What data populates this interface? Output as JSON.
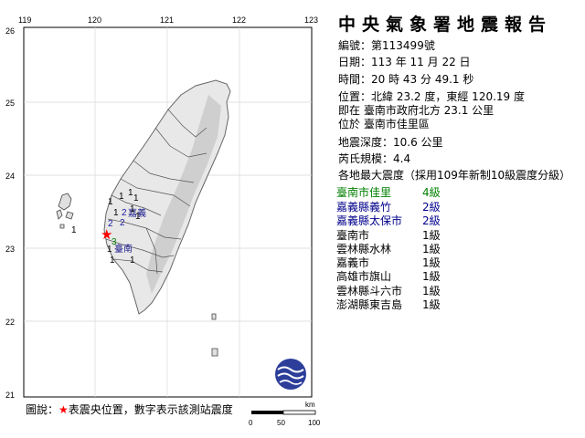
{
  "report": {
    "title": "中央氣象署地震報告",
    "number_label": "編號：",
    "number": "第113499號",
    "date_label": "日期：",
    "date": "113 年 11 月 22 日",
    "time_label": "時間：",
    "time": "20 時 43 分 49.1 秒",
    "position_label": "位置：",
    "position": "北緯 23.2 度，東經 120.19 度",
    "relative_line": "即在 臺南市政府北方 23.1 公里",
    "located_line": "位於 臺南市佳里區",
    "depth_label": "地震深度：",
    "depth": "10.6 公里",
    "magnitude_label": "芮氏規模：",
    "magnitude": "4.4",
    "intensity_heading": "各地最大震度（採用109年新制10級震度分級）"
  },
  "stations": [
    {
      "name": "臺南市佳里",
      "level": "4級",
      "color": "#008000"
    },
    {
      "name": "嘉義縣義竹",
      "level": "2級",
      "color": "#00008b"
    },
    {
      "name": "嘉義縣太保市",
      "level": "2級",
      "color": "#00008b"
    },
    {
      "name": "臺南市",
      "level": "1級",
      "color": "#000000"
    },
    {
      "name": "雲林縣水林",
      "level": "1級",
      "color": "#000000"
    },
    {
      "name": "嘉義市",
      "level": "1級",
      "color": "#000000"
    },
    {
      "name": "高雄市旗山",
      "level": "1級",
      "color": "#000000"
    },
    {
      "name": "雲林縣斗六市",
      "level": "1級",
      "color": "#000000"
    },
    {
      "name": "澎湖縣東吉島",
      "level": "1級",
      "color": "#000000"
    }
  ],
  "map": {
    "lon_ticks": [
      "119",
      "120",
      "121",
      "122",
      "123"
    ],
    "lat_ticks": [
      "26",
      "25",
      "24",
      "23",
      "22",
      "21"
    ],
    "city_labels": [
      "嘉義",
      "臺南"
    ],
    "intensity_marks": [
      "1",
      "1",
      "1",
      "1",
      "1",
      "2",
      "1",
      "1",
      "1",
      "2",
      "2",
      "3",
      "1",
      "1",
      "1"
    ],
    "scale_unit": "km",
    "scale_ticks": [
      "0",
      "50",
      "100"
    ]
  },
  "legend": {
    "prefix": "圖說：",
    "star": "★",
    "text": "表震央位置，數字表示該測站震度"
  }
}
